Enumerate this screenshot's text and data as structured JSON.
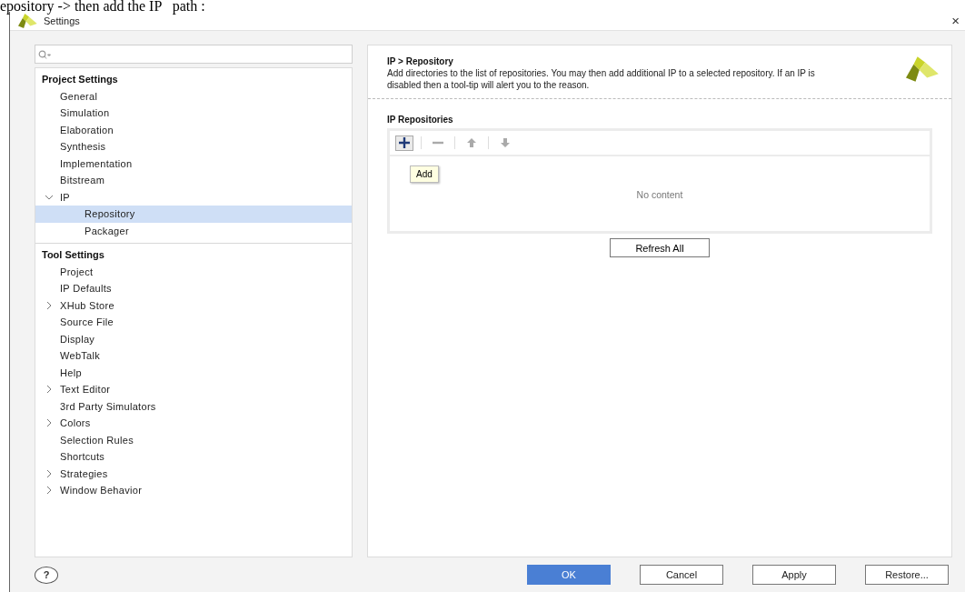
{
  "document_text": "epository -> then add the IP   path :",
  "window": {
    "title": "Settings",
    "close": "×"
  },
  "tree": [
    {
      "label": "Project Settings",
      "kind": "section",
      "children": [
        {
          "label": "General",
          "selected": false
        },
        {
          "label": "Simulation",
          "selected": false
        },
        {
          "label": "Elaboration",
          "selected": false
        },
        {
          "label": "Synthesis",
          "selected": false
        },
        {
          "label": "Implementation",
          "selected": false
        },
        {
          "label": "Bitstream",
          "selected": false
        },
        {
          "label": "IP",
          "selected": false,
          "expanded": true,
          "children": [
            {
              "label": "Repository",
              "selected": true
            },
            {
              "label": "Packager",
              "selected": false
            }
          ]
        }
      ]
    },
    {
      "label": "Tool Settings",
      "kind": "section",
      "children": [
        {
          "label": "Project",
          "selected": false
        },
        {
          "label": "IP Defaults",
          "selected": false
        },
        {
          "label": "XHub Store",
          "selected": false,
          "expanded": false
        },
        {
          "label": "Source File",
          "selected": false
        },
        {
          "label": "Display",
          "selected": false
        },
        {
          "label": "WebTalk",
          "selected": false
        },
        {
          "label": "Help",
          "selected": false
        },
        {
          "label": "Text Editor",
          "selected": false,
          "expanded": false
        },
        {
          "label": "3rd Party Simulators",
          "selected": false
        },
        {
          "label": "Colors",
          "selected": false,
          "expanded": false
        },
        {
          "label": "Selection Rules",
          "selected": false
        },
        {
          "label": "Shortcuts",
          "selected": false
        },
        {
          "label": "Strategies",
          "selected": false,
          "expanded": false
        },
        {
          "label": "Window Behavior",
          "selected": false,
          "expanded": false
        }
      ]
    }
  ],
  "page": {
    "title": "IP > Repository",
    "description": "Add directories to the list of repositories. You may then add additional IP to a selected repository. If an IP is disabled then a tool-tip will alert you to the reason."
  },
  "repositories": {
    "title": "IP Repositories",
    "toolbar": [
      {
        "kind": "add",
        "disabled": false,
        "pressed": true
      },
      {
        "kind": "remove",
        "disabled": true,
        "pressed": false
      },
      {
        "kind": "up",
        "disabled": true,
        "pressed": false
      },
      {
        "kind": "down",
        "disabled": true,
        "pressed": false
      }
    ],
    "tooltip": "Add",
    "empty_text": "No content",
    "refresh": "Refresh All"
  },
  "help": "?",
  "buttons": [
    {
      "label": "OK",
      "primary": true
    },
    {
      "label": "Cancel",
      "primary": false
    },
    {
      "label": "Apply",
      "primary": false
    },
    {
      "label": "Restore...",
      "primary": false
    }
  ]
}
